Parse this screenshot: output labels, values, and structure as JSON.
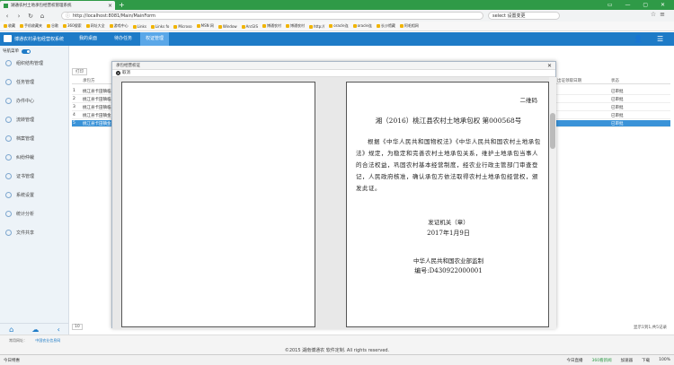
{
  "browser": {
    "tab_title": "湖通农村土地承包经营权管理系统",
    "url": "http://localhost:8081/Main/MainForm",
    "search_text": "select 设置变更",
    "window_controls": "▭ — ▢ ✕",
    "bookmarks": [
      "收藏",
      "手机收藏夹",
      "谷歌",
      "360搜索",
      "网址大全",
      "游戏中心",
      "Links",
      "Links fo",
      "Microso",
      "MSN 网",
      "Window",
      "ArcGIS",
      "博通农村",
      "博通农村",
      "http://",
      "oracle连",
      "oracle连",
      "长沙馆藏",
      "阿毛相网"
    ]
  },
  "app": {
    "title": "博通农村承包经营权系统",
    "nav_tabs": [
      "我的桌面",
      "待办任务",
      "权证管理"
    ],
    "user_icon": "person-icon",
    "menu_icon": "menu-icon"
  },
  "sidebar": {
    "nav_label": "导航菜单",
    "items": [
      "组织结构管理",
      "任务管理",
      "办件中心",
      "流转管理",
      "档案管理",
      "纠纷仲裁",
      "证书管理",
      "系统设置",
      "统计分析",
      "文件共享"
    ]
  },
  "main": {
    "print_label": "打印",
    "columns": {
      "code": "承包方",
      "date": "出证领取日期",
      "status": "状态"
    },
    "rows": [
      {
        "name": "桃江县卡田镇临",
        "status": "已审批"
      },
      {
        "name": "桃江县卡田镇临",
        "status": "已审批"
      },
      {
        "name": "桃江县卡田镇临",
        "status": "已审批"
      },
      {
        "name": "桃江县卡田镇金",
        "status": "已审批"
      },
      {
        "name": "桃江县卡田镇金",
        "status": "已审批"
      }
    ],
    "pager": {
      "page_size": "10",
      "summary": "显示1到1,共5记录"
    }
  },
  "modal": {
    "title": "承包经营权证",
    "close_label": "✕",
    "toolbar_label": "取消",
    "certificate": {
      "code_label": "二维码",
      "number": "湘（2016）桃江县农村土地承包权 第000568号",
      "body": "根据《中华人民共和国物权法》《中华人民共和国农村土地承包法》规定，为稳定和完善农村土地承包关系，维护土地承包当事人的合法权益，巩固农村基本经营制度，经农业行政主管部门审查登记，人民政府核准，确认承包方依法取得农村土地承包经营权，颁发此证。",
      "issuer": "发证机关（章）",
      "date": "2017年1月9日",
      "supervisor": "中华人民共和国农业部监制",
      "serial": "编号:D430922000001"
    }
  },
  "footer": {
    "links": [
      "常用网址：",
      "中国农业信息网"
    ],
    "copyright": "©2015 湖南博通农 软件定制. All rights reserved."
  },
  "status": {
    "left": "今日特惠",
    "news": "今日直播",
    "speed": "360看新闻",
    "download": "加速器",
    "dl_label": "下载",
    "zoom": "100%"
  }
}
